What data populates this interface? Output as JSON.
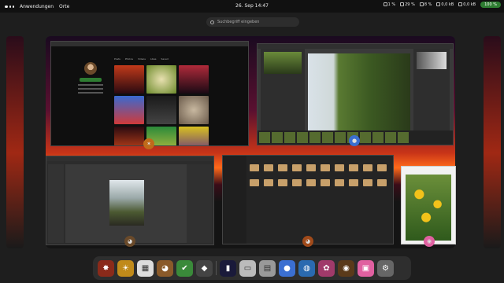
{
  "topbar": {
    "activities_label": "Anwendungen",
    "places_label": "Orte",
    "clock": "26. Sep 14:47",
    "tray": [
      {
        "icon": "cpu-icon",
        "value": "1 %"
      },
      {
        "icon": "memory-icon",
        "value": "29 %"
      },
      {
        "icon": "disk-icon",
        "value": "8 %"
      },
      {
        "icon": "download-icon",
        "value": "0,0 kB"
      },
      {
        "icon": "upload-icon",
        "value": "0,0 kB"
      }
    ],
    "battery": "100 %"
  },
  "search": {
    "placeholder": "Suchbegriff eingeben"
  },
  "browser": {
    "tabs": [
      "Posts",
      "Photos",
      "Videos",
      "Likes",
      "Saved"
    ]
  },
  "dock": {
    "apps": [
      "bug-app-icon",
      "sun-app-icon",
      "calendar-app-icon",
      "pet-app-icon",
      "checkmark-app-icon",
      "tux-app-icon",
      "terminal-app-icon",
      "monitor-app-icon",
      "disk-app-icon",
      "circle-app-icon",
      "globe-app-icon",
      "rgb-app-icon",
      "camera-app-icon",
      "image-app-icon",
      "tools-app-icon"
    ]
  },
  "colors": {
    "battery": "#2e7d32",
    "accent": "#3b6fd1"
  }
}
